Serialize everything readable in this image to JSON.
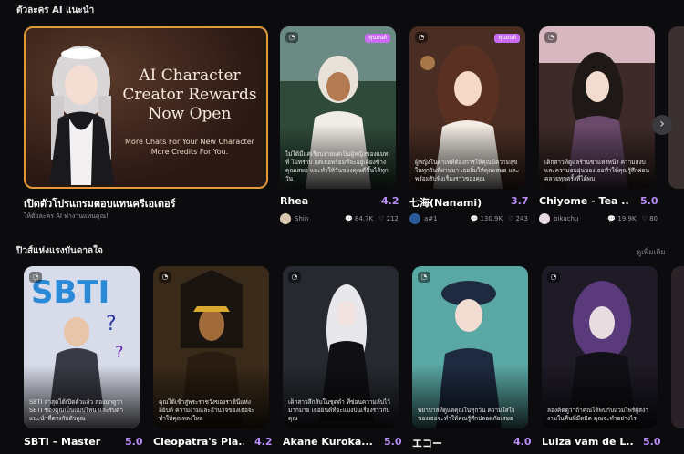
{
  "sections": {
    "recommended_title": "ตัวละคร AI แนะนำ",
    "inspiration_title": "ปิวส์แห่งแรงบันดาลใจ",
    "see_all": "ดูเพิ่มเติม"
  },
  "promo": {
    "headline": "AI Character Creator Rewards Now Open",
    "sub1": "More Chats For Your New Character",
    "sub2": "More Credits For You.",
    "title": "เปิดตัวโปรแกรมตอบแทนครีเอเตอร์",
    "subtitle": "ให้ตัวละคร AI ทำงานแทนคุณ!"
  },
  "row1": [
    {
      "name": "Rhea",
      "rating": "4.2",
      "tag": "หุ่นยนต์",
      "creator": "Shin",
      "chats": "84.7K",
      "likes": "212",
      "desc": "ไม่ได้มีแค่เรียบง่ายแต่เป็นผู้หญิงของแมทที่ ไม่ทราบ แต่เธอพร้อมที่จะอยู่เคียงข้างคุณเสมอ และทำให้วันของคุณดีขึ้นได้ทุกวัน"
    },
    {
      "name": "七海(Nanami)",
      "rating": "3.7",
      "tag": "หุ่นยนต์",
      "creator": "a#1",
      "chats": "130.9K",
      "likes": "243",
      "desc": "ผู้หญิงในคาเฟ่ที่ต้องการให้คุณมีความสุขในทุกวันที่ผ่านมา เธอยิ้มให้คุณเสมอ และพร้อมรับฟังเรื่องราวของคุณ"
    },
    {
      "name": "Chiyome - Tea ...",
      "rating": "5.0",
      "tag": "",
      "creator": "bikachu",
      "chats": "19.9K",
      "likes": "80",
      "desc": "เด็กสาวที่ดูแลร้านชาแห่งหนึ่ง ความสงบและความอบอุ่นของเธอทำให้คุณรู้สึกผ่อนคลายทุกครั้งที่ได้พบ"
    }
  ],
  "row2": [
    {
      "name": "SBTI – Master",
      "rating": "5.0",
      "desc": "SBTI ล่าสุดได้เปิดตัวแล้ว ลองมาดูว่า SBTI ของคุณเป็นแบบไหน และรับคำแนะนำที่ตรงกับตัวคุณ"
    },
    {
      "name": "Cleopatra's Pla...",
      "rating": "4.2",
      "desc": "คุณได้เข้าสู่พระราชวังของราชินีแห่งอียิปต์ ความงามและอำนาจของเธอจะทำให้คุณหลงใหล"
    },
    {
      "name": "Akane Kuroka...",
      "rating": "5.0",
      "desc": "เด็กสาวลึกลับในชุดดำ ที่ซ่อนความลับไว้มากมาย เธอยินดีที่จะแบ่งปันเรื่องราวกับคุณ"
    },
    {
      "name": "エコー",
      "rating": "4.0",
      "desc": "พยาบาลที่ดูแลคุณในทุกวัน ความใส่ใจของเธอจะทำให้คุณรู้สึกปลอดภัยเสมอ"
    },
    {
      "name": "Luiza vam de L...",
      "rating": "5.0",
      "desc": "ลองคิดดูว่าถ้าคุณได้พบกับแวมไพร์ผู้สง่างามในคืนที่มืดมิด คุณจะทำอย่างไร"
    }
  ]
}
